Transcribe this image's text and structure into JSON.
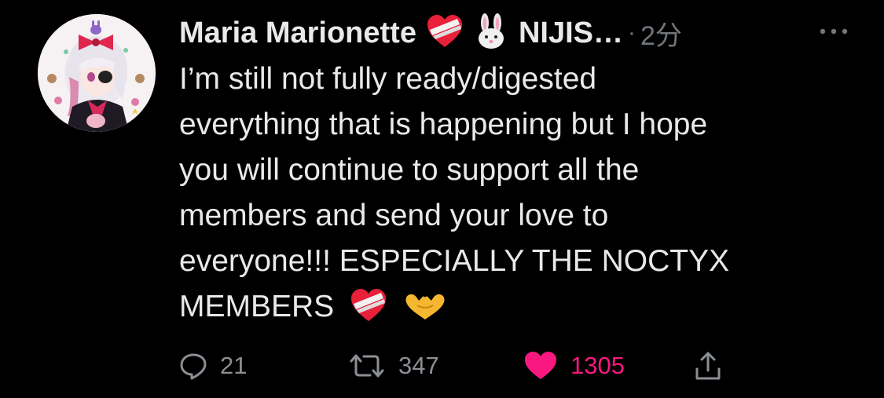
{
  "tweet": {
    "author_name": "Maria Marionette",
    "author_handle": "NIJIS…",
    "separator": "·",
    "time": "2分",
    "more_label": "…",
    "text_lines": [
      "I’m still not fully ready/digested",
      "everything that is happening but I hope",
      "you will continue to support all the",
      "members and send your love to",
      "everyone!!! ESPECIALLY THE NOCTYX",
      "MEMBERS"
    ],
    "name_emojis": [
      "mending-heart-icon",
      "rabbit-face-icon"
    ],
    "text_emojis": [
      "mending-heart-icon",
      "heart-hands-icon"
    ]
  },
  "actions": {
    "reply_count": "21",
    "retweet_count": "347",
    "like_count": "1305",
    "liked": true
  },
  "colors": {
    "background": "#000000",
    "text": "#e7e9ea",
    "muted": "#71767b",
    "like": "#f91880"
  }
}
